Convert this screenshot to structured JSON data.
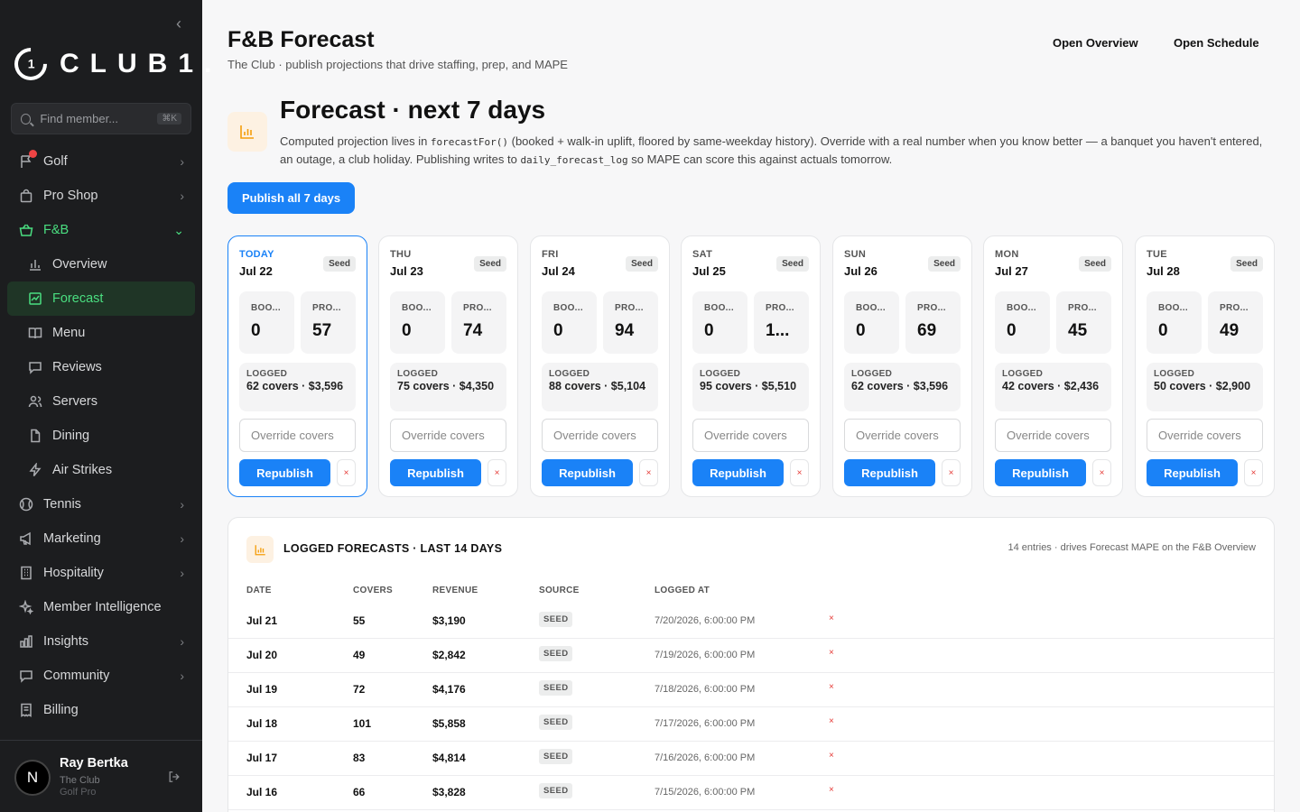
{
  "sidebar": {
    "logo_text": "CLUB1.",
    "logo_mark": "1",
    "search": {
      "placeholder": "Find member...",
      "shortcut": "⌘K"
    },
    "items": [
      {
        "label": "Golf",
        "icon": "flag-icon"
      },
      {
        "label": "Pro Shop",
        "icon": "shopping-bag-icon"
      },
      {
        "label": "F&B",
        "icon": "basket-icon"
      },
      {
        "label": "Overview",
        "icon": "bar-chart-icon"
      },
      {
        "label": "Forecast",
        "icon": "forecast-chart-icon"
      },
      {
        "label": "Menu",
        "icon": "book-icon"
      },
      {
        "label": "Reviews",
        "icon": "chat-icon"
      },
      {
        "label": "Servers",
        "icon": "users-icon"
      },
      {
        "label": "Dining",
        "icon": "document-icon"
      },
      {
        "label": "Air Strikes",
        "icon": "lightning-icon"
      },
      {
        "label": "Tennis",
        "icon": "tennis-icon"
      },
      {
        "label": "Marketing",
        "icon": "megaphone-icon"
      },
      {
        "label": "Hospitality",
        "icon": "building-icon"
      },
      {
        "label": "Member Intelligence",
        "icon": "sparkle-icon"
      },
      {
        "label": "Insights",
        "icon": "insights-icon"
      },
      {
        "label": "Community",
        "icon": "chat-icon"
      },
      {
        "label": "Billing",
        "icon": "receipt-icon"
      }
    ],
    "user": {
      "initial": "N",
      "name": "Ray Bertka",
      "club": "The Club",
      "role": "Golf Pro"
    }
  },
  "header": {
    "title": "F&B Forecast",
    "subtitle": "The Club · publish projections that drive staffing, prep, and MAPE",
    "links": [
      "Open Overview",
      "Open Schedule"
    ]
  },
  "hero": {
    "title": "Forecast · next 7 days",
    "desc_1": "Computed projection lives in ",
    "code_1": "forecastFor()",
    "desc_2": " (booked + walk-in uplift, floored by same-weekday history). Override with a real number when you know better — a banquet you haven't entered, an outage, a club holiday. Publishing writes to ",
    "code_2": "daily_forecast_log",
    "desc_3": " so MAPE can score this against actuals tomorrow.",
    "publish_label": "Publish all 7 days"
  },
  "days": [
    {
      "label": "TODAY",
      "date": "Jul 22",
      "badge": "Seed",
      "booked_label": "BOO...",
      "booked": "0",
      "proj_label": "PRO...",
      "proj": "57",
      "logged_label": "LOGGED",
      "logged": "62 covers · $3,596",
      "placeholder": "Override covers",
      "button": "Republish",
      "clear": "×"
    },
    {
      "label": "THU",
      "date": "Jul 23",
      "badge": "Seed",
      "booked_label": "BOO...",
      "booked": "0",
      "proj_label": "PRO...",
      "proj": "74",
      "logged_label": "LOGGED",
      "logged": "75 covers · $4,350",
      "placeholder": "Override covers",
      "button": "Republish",
      "clear": "×"
    },
    {
      "label": "FRI",
      "date": "Jul 24",
      "badge": "Seed",
      "booked_label": "BOO...",
      "booked": "0",
      "proj_label": "PRO...",
      "proj": "94",
      "logged_label": "LOGGED",
      "logged": "88 covers · $5,104",
      "placeholder": "Override covers",
      "button": "Republish",
      "clear": "×"
    },
    {
      "label": "SAT",
      "date": "Jul 25",
      "badge": "Seed",
      "booked_label": "BOO...",
      "booked": "0",
      "proj_label": "PRO...",
      "proj": "1...",
      "logged_label": "LOGGED",
      "logged": "95 covers · $5,510",
      "placeholder": "Override covers",
      "button": "Republish",
      "clear": "×"
    },
    {
      "label": "SUN",
      "date": "Jul 26",
      "badge": "Seed",
      "booked_label": "BOO...",
      "booked": "0",
      "proj_label": "PRO...",
      "proj": "69",
      "logged_label": "LOGGED",
      "logged": "62 covers · $3,596",
      "placeholder": "Override covers",
      "button": "Republish",
      "clear": "×"
    },
    {
      "label": "MON",
      "date": "Jul 27",
      "badge": "Seed",
      "booked_label": "BOO...",
      "booked": "0",
      "proj_label": "PRO...",
      "proj": "45",
      "logged_label": "LOGGED",
      "logged": "42 covers · $2,436",
      "placeholder": "Override covers",
      "button": "Republish",
      "clear": "×"
    },
    {
      "label": "TUE",
      "date": "Jul 28",
      "badge": "Seed",
      "booked_label": "BOO...",
      "booked": "0",
      "proj_label": "PRO...",
      "proj": "49",
      "logged_label": "LOGGED",
      "logged": "50 covers · $2,900",
      "placeholder": "Override covers",
      "button": "Republish",
      "clear": "×"
    }
  ],
  "log": {
    "title": "LOGGED FORECASTS · LAST 14 DAYS",
    "note": "14 entries · drives Forecast MAPE on the F&B Overview",
    "columns": [
      "DATE",
      "COVERS",
      "REVENUE",
      "SOURCE",
      "LOGGED AT"
    ],
    "rows": [
      {
        "date": "Jul 21",
        "covers": "55",
        "revenue": "$3,190",
        "source": "SEED",
        "logged_at": "7/20/2026, 6:00:00 PM",
        "delete": "×"
      },
      {
        "date": "Jul 20",
        "covers": "49",
        "revenue": "$2,842",
        "source": "SEED",
        "logged_at": "7/19/2026, 6:00:00 PM",
        "delete": "×"
      },
      {
        "date": "Jul 19",
        "covers": "72",
        "revenue": "$4,176",
        "source": "SEED",
        "logged_at": "7/18/2026, 6:00:00 PM",
        "delete": "×"
      },
      {
        "date": "Jul 18",
        "covers": "101",
        "revenue": "$5,858",
        "source": "SEED",
        "logged_at": "7/17/2026, 6:00:00 PM",
        "delete": "×"
      },
      {
        "date": "Jul 17",
        "covers": "83",
        "revenue": "$4,814",
        "source": "SEED",
        "logged_at": "7/16/2026, 6:00:00 PM",
        "delete": "×"
      },
      {
        "date": "Jul 16",
        "covers": "66",
        "revenue": "$3,828",
        "source": "SEED",
        "logged_at": "7/15/2026, 6:00:00 PM",
        "delete": "×"
      }
    ]
  },
  "colors": {
    "accent": "#1a82f7",
    "active_nav": "#4ade80",
    "sidebar_bg": "#1c1d1f",
    "danger": "#e53935"
  }
}
